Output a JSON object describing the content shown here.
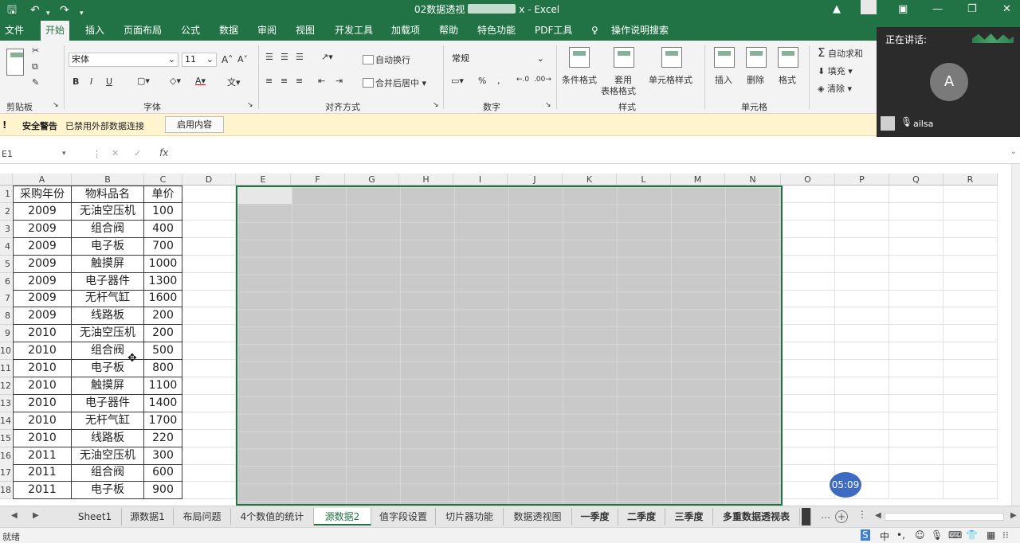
{
  "window": {
    "title_left": "02数据透视",
    "title_right": "x  -  Excel",
    "accent": "#217346"
  },
  "tabs": [
    "文件",
    "开始",
    "插入",
    "页面布局",
    "公式",
    "数据",
    "审阅",
    "视图",
    "开发工具",
    "加载项",
    "帮助",
    "特色功能",
    "PDF工具",
    "操作说明搜索"
  ],
  "ribbon": {
    "font_name": "宋体",
    "font_size": "11",
    "wrap_text": "自动换行",
    "merge_center": "合并后居中",
    "number_format": "常规",
    "cond_format": "条件格式",
    "table_format_1": "套用",
    "table_format_2": "表格格式",
    "cell_style": "单元格样式",
    "insert": "插入",
    "delete": "删除",
    "format": "格式",
    "autosum": "自动求和",
    "fill": "填充",
    "clear": "清除",
    "groups": {
      "clipboard": "剪贴板",
      "font": "字体",
      "alignment": "对齐方式",
      "number": "数字",
      "styles": "样式",
      "cells": "单元格"
    }
  },
  "meeting": {
    "speaking_label": "正在讲话:",
    "avatar_letter": "A",
    "user_name": "ailsa"
  },
  "security": {
    "title": "安全警告",
    "message": "已禁用外部数据连接",
    "button": "启用内容"
  },
  "formula_bar": {
    "name_box": "E1",
    "fx": "fx"
  },
  "columns": [
    "A",
    "B",
    "C",
    "D",
    "E",
    "F",
    "G",
    "H",
    "I",
    "J",
    "K",
    "L",
    "M",
    "N",
    "O",
    "P",
    "Q",
    "R"
  ],
  "rows": [
    "1",
    "2",
    "3",
    "4",
    "5",
    "6",
    "7",
    "8",
    "9",
    "10",
    "11",
    "12",
    "13",
    "14",
    "15",
    "16",
    "17",
    "18"
  ],
  "table": {
    "headers": [
      "采购年份",
      "物料品名",
      "单价"
    ],
    "rows": [
      [
        "2009",
        "无油空压机",
        "100"
      ],
      [
        "2009",
        "组合阀",
        "400"
      ],
      [
        "2009",
        "电子板",
        "700"
      ],
      [
        "2009",
        "触摸屏",
        "1000"
      ],
      [
        "2009",
        "电子器件",
        "1300"
      ],
      [
        "2009",
        "无杆气缸",
        "1600"
      ],
      [
        "2009",
        "线路板",
        "200"
      ],
      [
        "2010",
        "无油空压机",
        "200"
      ],
      [
        "2010",
        "组合阀",
        "500"
      ],
      [
        "2010",
        "电子板",
        "800"
      ],
      [
        "2010",
        "触摸屏",
        "1100"
      ],
      [
        "2010",
        "电子器件",
        "1400"
      ],
      [
        "2010",
        "无杆气缸",
        "1700"
      ],
      [
        "2010",
        "线路板",
        "220"
      ],
      [
        "2011",
        "无油空压机",
        "300"
      ],
      [
        "2011",
        "组合阀",
        "600"
      ],
      [
        "2011",
        "电子板",
        "900"
      ]
    ]
  },
  "timer": "05:09",
  "sheets": [
    "Sheet1",
    "源数据1",
    "布局问题",
    "4个数值的统计",
    "源数据2",
    "值字段设置",
    "切片器功能",
    "数据透视图",
    "一季度",
    "二季度",
    "三季度",
    "多重数据透视表"
  ],
  "active_sheet": "源数据2",
  "status": {
    "ready": "就绪",
    "ime": "中"
  }
}
